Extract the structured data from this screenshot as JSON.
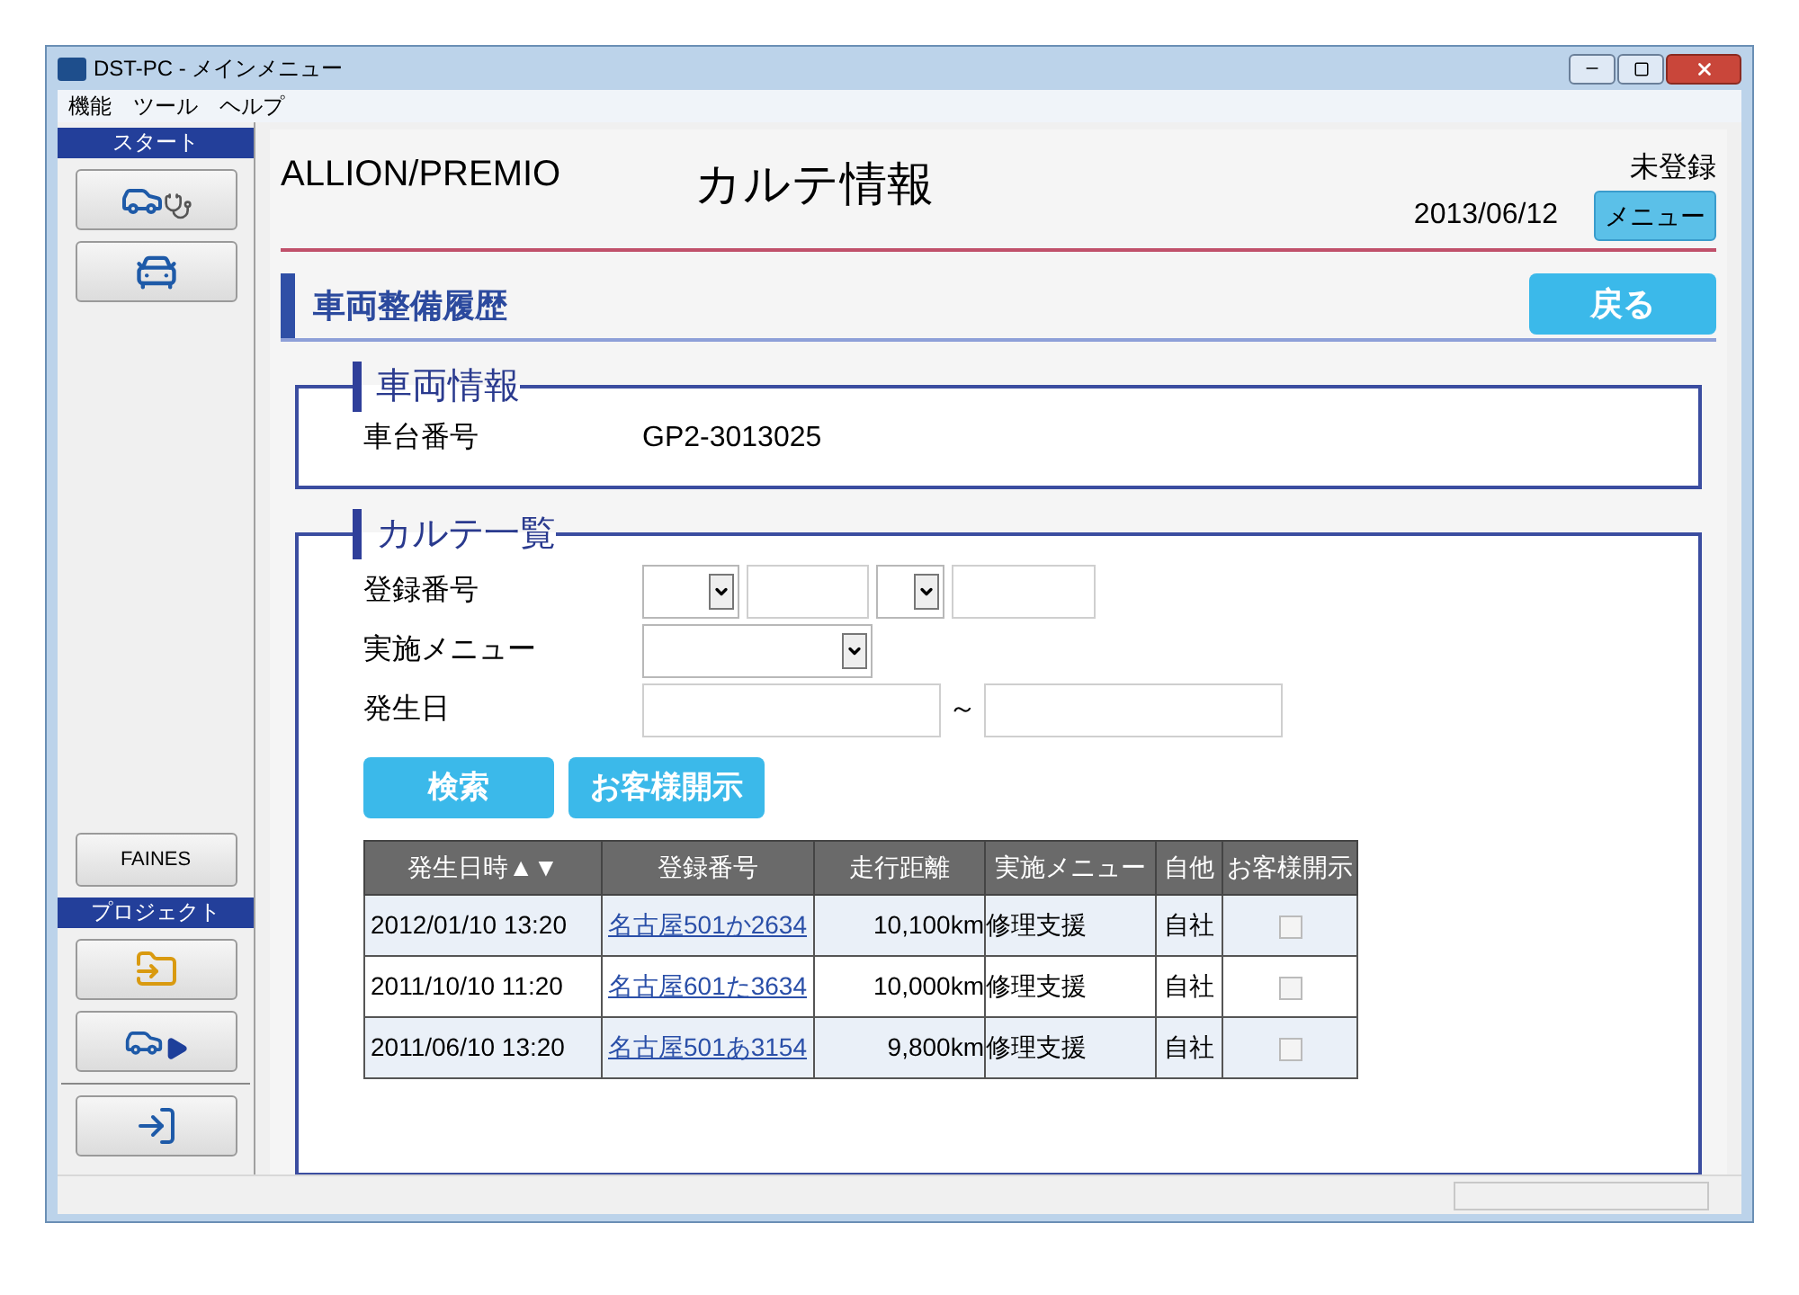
{
  "window": {
    "title": "DST-PC - メインメニュー"
  },
  "menu_bar": [
    "機能",
    "ツール",
    "ヘルプ"
  ],
  "sidebar": {
    "start_title": "スタート",
    "faines_button": "FAINES",
    "project_title": "プロジェクト"
  },
  "header": {
    "model": "ALLION/PREMIO",
    "title": "カルテ情報",
    "status": "未登録",
    "date": "2013/06/12",
    "menu_button": "メニュー"
  },
  "section": {
    "title": "車両整備履歴",
    "back_button": "戻る"
  },
  "vehicle_info": {
    "title": "車両情報",
    "fields": [
      {
        "label": "車台番号",
        "value": "GP2-3013025"
      }
    ]
  },
  "karte_list": {
    "title": "カルテ一覧",
    "filters": [
      {
        "kind": "reg_number",
        "label": "登録番号"
      },
      {
        "kind": "select",
        "label": "実施メニュー"
      },
      {
        "kind": "date_range",
        "label": "発生日",
        "separator": "～"
      }
    ],
    "buttons": [
      "検索",
      "お客様開示"
    ],
    "table": {
      "columns": [
        "発生日時▲▼",
        "登録番号",
        "走行距離",
        "実施メニュー",
        "自他",
        "お客様開示"
      ],
      "rows": [
        {
          "date": "2012/01/10 13:20",
          "number": "名古屋501か2634",
          "distance": "10,100km",
          "menu": "修理支援",
          "owner": "自社",
          "disclosed": false
        },
        {
          "date": "2011/10/10 11:20",
          "number": "名古屋601た3634",
          "distance": "10,000km",
          "menu": "修理支援",
          "owner": "自社",
          "disclosed": false
        },
        {
          "date": "2011/06/10 13:20",
          "number": "名古屋501あ3154",
          "distance": "9,800km",
          "menu": "修理支援",
          "owner": "自社",
          "disclosed": false
        }
      ]
    }
  }
}
